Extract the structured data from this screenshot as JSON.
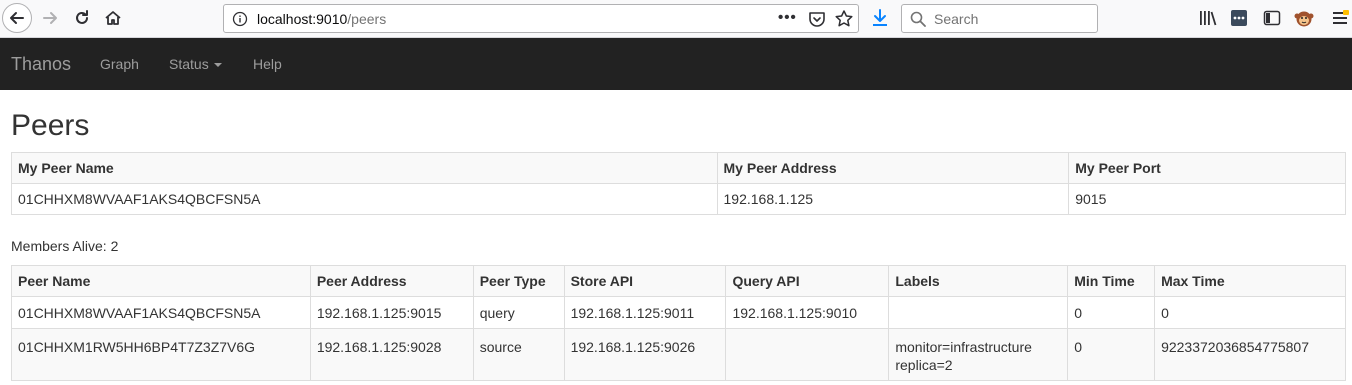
{
  "browser": {
    "url_host": "localhost:9010",
    "url_path": "/peers",
    "search_placeholder": "Search"
  },
  "navbar": {
    "brand": "Thanos",
    "links": [
      {
        "label": "Graph"
      },
      {
        "label": "Status"
      },
      {
        "label": "Help"
      }
    ]
  },
  "page": {
    "title": "Peers",
    "members_alive": "Members Alive: 2"
  },
  "self_table": {
    "headers": [
      "My Peer Name",
      "My Peer Address",
      "My Peer Port"
    ],
    "row": [
      "01CHHXM8WVAAF1AKS4QBCFSN5A",
      "192.168.1.125",
      "9015"
    ]
  },
  "peers_table": {
    "headers": [
      "Peer Name",
      "Peer Address",
      "Peer Type",
      "Store API",
      "Query API",
      "Labels",
      "Min Time",
      "Max Time"
    ],
    "rows": [
      {
        "name": "01CHHXM8WVAAF1AKS4QBCFSN5A",
        "address": "192.168.1.125:9015",
        "type": "query",
        "store_api": "192.168.1.125:9011",
        "query_api": "192.168.1.125:9010",
        "labels": [
          "",
          ""
        ],
        "min_time": "0",
        "max_time": "0"
      },
      {
        "name": "01CHHXM1RW5HH6BP4T7Z3Z7V6G",
        "address": "192.168.1.125:9028",
        "type": "source",
        "store_api": "192.168.1.125:9026",
        "query_api": "",
        "labels": [
          "monitor=infrastructure",
          "replica=2"
        ],
        "min_time": "0",
        "max_time": "9223372036854775807"
      }
    ]
  },
  "icons": {
    "back": "back-arrow-icon",
    "forward": "forward-arrow-icon",
    "reload": "reload-icon",
    "home": "home-icon",
    "info": "info-icon",
    "more": "more-dots-icon",
    "pocket": "pocket-icon",
    "bookmark": "star-icon",
    "download": "download-icon",
    "search": "search-icon",
    "library": "library-icon",
    "extension": "extension-icon",
    "sidebar": "sidebar-icon",
    "monkey": "monkey-extension-icon",
    "menu": "hamburger-menu-icon"
  },
  "colors": {
    "navbar_bg": "#222222",
    "navbar_text": "#9d9d9d",
    "download_accent": "#0a84ff"
  }
}
